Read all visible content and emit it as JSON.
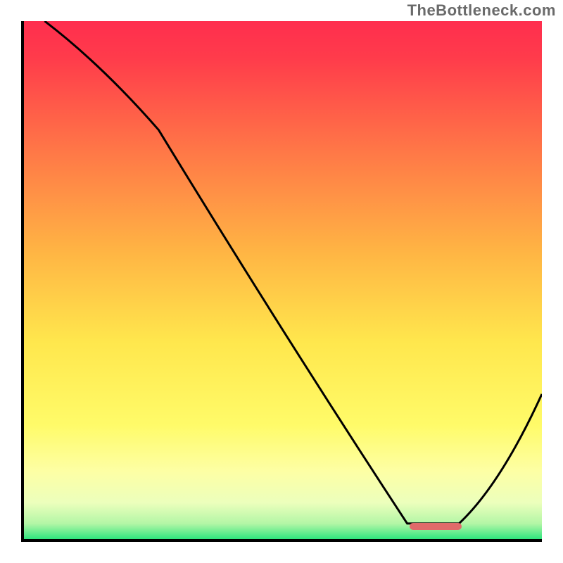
{
  "watermark": "TheBottleneck.com",
  "chart_data": {
    "type": "line",
    "title": "",
    "xlabel": "",
    "ylabel": "",
    "xlim": [
      0,
      100
    ],
    "ylim": [
      0,
      100
    ],
    "grid": false,
    "background": "gradient red-yellow-green",
    "series": [
      {
        "name": "curve",
        "x": [
          4,
          26,
          74,
          84,
          100
        ],
        "y": [
          100,
          79,
          3,
          3,
          28
        ]
      }
    ],
    "marker": {
      "x_start": 74,
      "x_end": 84,
      "y": 3,
      "color": "#e16a6a"
    },
    "gradient_stops": [
      {
        "offset": 0.0,
        "color": "#ff2e4e"
      },
      {
        "offset": 0.07,
        "color": "#ff3b4b"
      },
      {
        "offset": 0.25,
        "color": "#ff7747"
      },
      {
        "offset": 0.45,
        "color": "#ffb644"
      },
      {
        "offset": 0.62,
        "color": "#ffe74d"
      },
      {
        "offset": 0.78,
        "color": "#fffb69"
      },
      {
        "offset": 0.87,
        "color": "#fdffa5"
      },
      {
        "offset": 0.93,
        "color": "#ecffbc"
      },
      {
        "offset": 0.97,
        "color": "#b3f6a6"
      },
      {
        "offset": 1.0,
        "color": "#2fe57e"
      }
    ]
  }
}
